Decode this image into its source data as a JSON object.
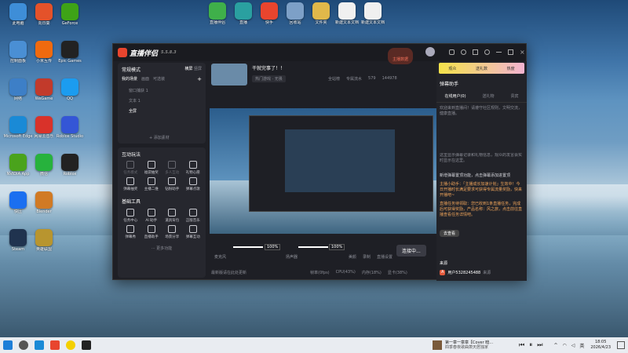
{
  "desktop": {
    "icons": [
      {
        "label": "此电脑",
        "color": "#3e8ed8"
      },
      {
        "label": "控制面板",
        "color": "#4a8fd4"
      },
      {
        "label": "网络",
        "color": "#3d7fc7"
      },
      {
        "label": "Microsoft Edge",
        "color": "#1a8ad6"
      },
      {
        "label": "NVIDIA App",
        "color": "#4aa31c"
      },
      {
        "label": "快压",
        "color": "#1b6ff0"
      },
      {
        "label": "Steam",
        "color": "#20334f"
      },
      {
        "label": "向日葵",
        "color": "#e4522a"
      },
      {
        "label": "小米互传",
        "color": "#f06a0f"
      },
      {
        "label": "WeGame",
        "color": "#c23a2b"
      },
      {
        "label": "网易云音乐",
        "color": "#d9322a"
      },
      {
        "label": "微信",
        "color": "#27b23d"
      },
      {
        "label": "Blender",
        "color": "#d17a24"
      },
      {
        "label": "英雄联盟",
        "color": "#b8952f"
      },
      {
        "label": "GeForce",
        "color": "#3ea317"
      },
      {
        "label": "Epic Games",
        "color": "#222"
      },
      {
        "label": "QQ",
        "color": "#1b9cf0"
      },
      {
        "label": "Roblox Studio",
        "color": "#3456d6"
      },
      {
        "label": "Roblox",
        "color": "#222"
      }
    ]
  },
  "top_icons": [
    {
      "label": "直播伴侣",
      "color": "#3fb04a"
    },
    {
      "label": "直播",
      "color": "#2aa0a0"
    },
    {
      "label": "快手",
      "color": "#e8452e"
    },
    {
      "label": "回收站",
      "color": "#7da0c7"
    },
    {
      "label": "文件夹",
      "color": "#e0b84a"
    },
    {
      "label": "新建文本文档",
      "color": "#f0f0f0"
    },
    {
      "label": "新建文本文档",
      "color": "#f0f0f0"
    }
  ],
  "app": {
    "name": "直播伴侣",
    "version": "5.5.8.3",
    "status_btn": "主播数据",
    "left": {
      "mode_title": "常规模式",
      "tab_landscape": "横屏",
      "tab_portrait": "竖屏",
      "scene_tabs": [
        "我的场景",
        "画面",
        "可选装"
      ],
      "sources": [
        "窗口捕获 1",
        "文本 1",
        "全屏"
      ],
      "add_source": "添加素材",
      "interact_title": "互动玩法",
      "interact_tools": [
        {
          "label": "任务模式",
          "dim": true
        },
        {
          "label": "福袋抽奖",
          "dim": false
        },
        {
          "label": "多人互动",
          "dim": true
        },
        {
          "label": "礼物心愿",
          "dim": false
        },
        {
          "label": "弹幕抽奖",
          "dim": false
        },
        {
          "label": "主播二维",
          "dim": false
        },
        {
          "label": "钻粉助手",
          "dim": false
        },
        {
          "label": "弹幕点歌",
          "dim": false
        }
      ],
      "basic_title": "基础工具",
      "basic_tools": [
        {
          "label": "任务中心",
          "dim": false
        },
        {
          "label": "AI 助手",
          "dim": false
        },
        {
          "label": "道具背包",
          "dim": false
        },
        {
          "label": "正版音乐",
          "dim": false
        },
        {
          "label": "弹幕秀",
          "dim": false
        },
        {
          "label": "直播助手",
          "dim": false
        },
        {
          "label": "场景分享",
          "dim": false
        },
        {
          "label": "弹幕互动",
          "dim": false
        }
      ],
      "more": "更多功能"
    },
    "stream": {
      "title": "干就完事了！！",
      "category": "热门游戏 · 无畏",
      "stats": [
        "全站榜",
        "专属流水",
        "579",
        "144978"
      ],
      "mic_label": "麦克风",
      "mic_pct": "100%",
      "spk_label": "扬声器",
      "spk_pct": "100%",
      "btns": [
        "美颜",
        "录制",
        "直播设置"
      ],
      "start_btn": "连接中...",
      "status_bar": [
        "帧率(0fps)",
        "CPU(43%)",
        "内存(18%)",
        "显卡(38%)"
      ],
      "footer_hint": "最新版请在此处更新"
    },
    "right": {
      "gift_labels": [
        "观众",
        "送礼数",
        "热度"
      ],
      "tabs": [
        "弹幕助手"
      ],
      "subtabs": [
        "在线用户(0)",
        "送礼物",
        "贵宾"
      ],
      "notice1": "欢迎来到直播间！请遵守社区规则，文明交流，健康直播。",
      "notice2": "这里显示弹幕记录和礼物信息，观众的发言会实时显示在这里。",
      "notice3": "新增弹幕置顶功能，点击弹幕添加进置顶",
      "notice4": "主播小助手：「主播成长加速计划」生效中！今日开播时长满足要求可获得专属流量奖励，快来开播吧~",
      "notice5": "直播任务待领取：您已收到1条直播任务，完成后可获得奖励，产品名称：风之旅，点击前往直播查看任务详情吧。",
      "go_btn": "去查看",
      "source_label": "来源",
      "user_id": "用户5328245488",
      "user_tag": "来源"
    }
  },
  "taskbar": {
    "media_title": "第一章一章章【Cover 暗...",
    "media_sub": "四季春夜歌曲萧天居独家",
    "lang": "英",
    "time": "18:05",
    "date": "2026/4/23"
  }
}
